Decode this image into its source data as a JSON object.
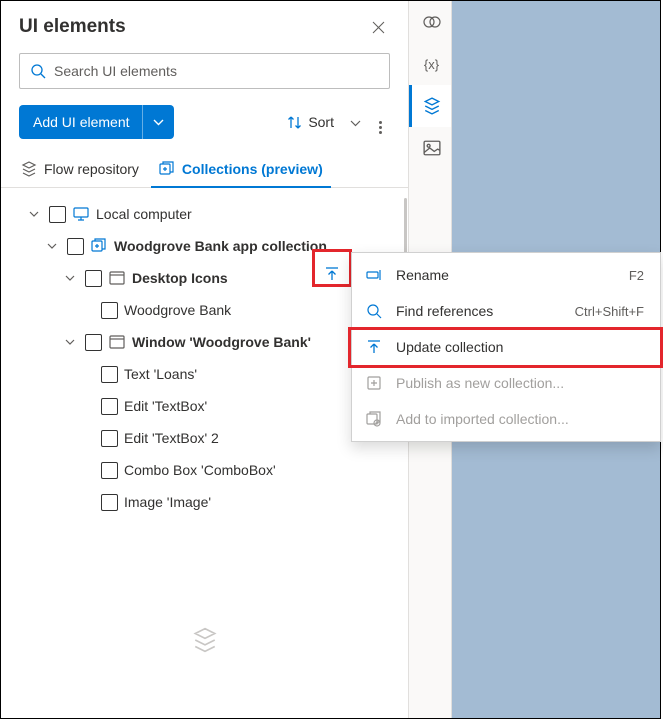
{
  "header": {
    "title": "UI elements"
  },
  "search": {
    "placeholder": "Search UI elements"
  },
  "toolbar": {
    "add_label": "Add UI element",
    "sort_label": "Sort"
  },
  "tabs": {
    "flow": "Flow repository",
    "collections": "Collections (preview)"
  },
  "tree": {
    "root": "Local computer",
    "collection": "Woodgrove Bank app collection",
    "group1": "Desktop Icons",
    "item1": "Woodgrove Bank",
    "group2": "Window 'Woodgrove Bank'",
    "items2": [
      "Text 'Loans'",
      "Edit 'TextBox'",
      "Edit 'TextBox' 2",
      "Combo Box 'ComboBox'",
      "Image 'Image'"
    ]
  },
  "context_menu": [
    {
      "label": "Rename",
      "shortcut": "F2",
      "icon": "rename",
      "disabled": false
    },
    {
      "label": "Find references",
      "shortcut": "Ctrl+Shift+F",
      "icon": "search",
      "disabled": false
    },
    {
      "label": "Update collection",
      "shortcut": "",
      "icon": "upload",
      "disabled": false
    },
    {
      "label": "Publish as new collection...",
      "shortcut": "",
      "icon": "publish",
      "disabled": true
    },
    {
      "label": "Add to imported collection...",
      "shortcut": "",
      "icon": "import",
      "disabled": true
    }
  ]
}
